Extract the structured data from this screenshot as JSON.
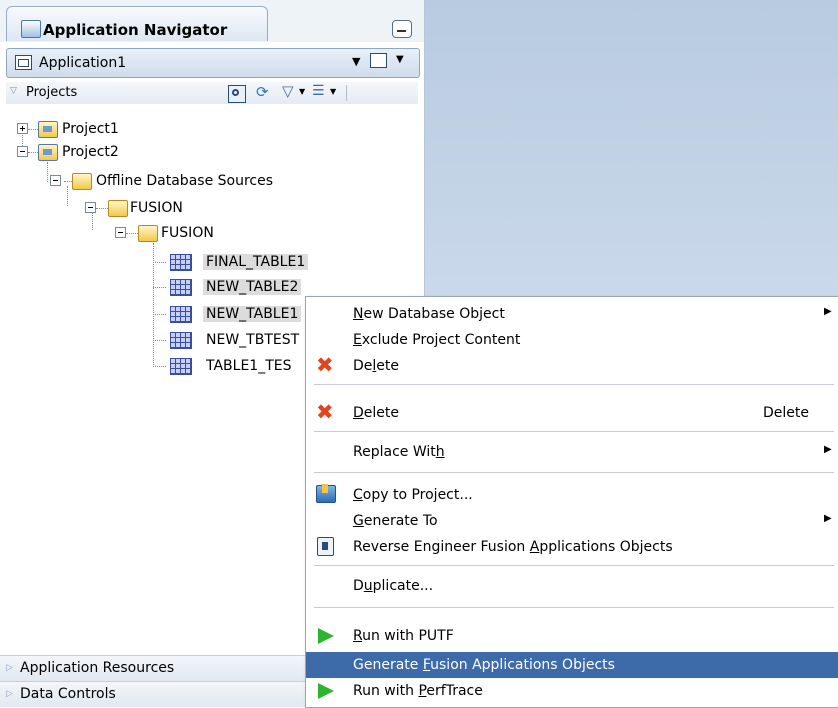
{
  "navigator": {
    "title": "Application Navigator",
    "application": "Application1",
    "projects_label": "Projects",
    "tree": {
      "project1": "Project1",
      "project2": "Project2",
      "offline_sources": "Offline Database Sources",
      "fusion1": "FUSION",
      "fusion2": "FUSION",
      "tables": [
        "FINAL_TABLE1",
        "NEW_TABLE2",
        "NEW_TABLE1",
        "NEW_TBTEST",
        "TABLE1_TES"
      ]
    },
    "bottom": {
      "app_resources": "Application Resources",
      "data_controls": "Data Controls"
    }
  },
  "context_menu": {
    "new_db_object": {
      "pre": "",
      "mn": "N",
      "post": "ew Database Object"
    },
    "exclude": {
      "pre": "",
      "mn": "E",
      "post": "xclude Project Content"
    },
    "delete1": {
      "pre": "De",
      "mn": "l",
      "post": "ete"
    },
    "delete2": {
      "pre": "",
      "mn": "D",
      "post": "elete",
      "accel": "Delete"
    },
    "replace": {
      "pre": "Replace Wit",
      "mn": "h",
      "post": ""
    },
    "copy": {
      "pre": "",
      "mn": "C",
      "post": "opy to Project..."
    },
    "generate_to": {
      "pre": "",
      "mn": "G",
      "post": "enerate To"
    },
    "reverse": {
      "pre": "Reverse Engineer Fusion ",
      "mn": "A",
      "post": "pplications Objects"
    },
    "duplicate": {
      "pre": "D",
      "mn": "u",
      "post": "plicate..."
    },
    "run_putf": {
      "pre": "",
      "mn": "R",
      "post": "un with PUTF"
    },
    "generate_fusion": {
      "pre": "Generate ",
      "mn": "F",
      "post": "usion Applications Objects"
    },
    "run_perftrace": {
      "pre": "Run with ",
      "mn": "P",
      "post": "erfTrace"
    }
  },
  "colors": {
    "highlight": "#3d6aa8",
    "delete_icon": "#e0451d",
    "run_icon": "#2db52d"
  }
}
